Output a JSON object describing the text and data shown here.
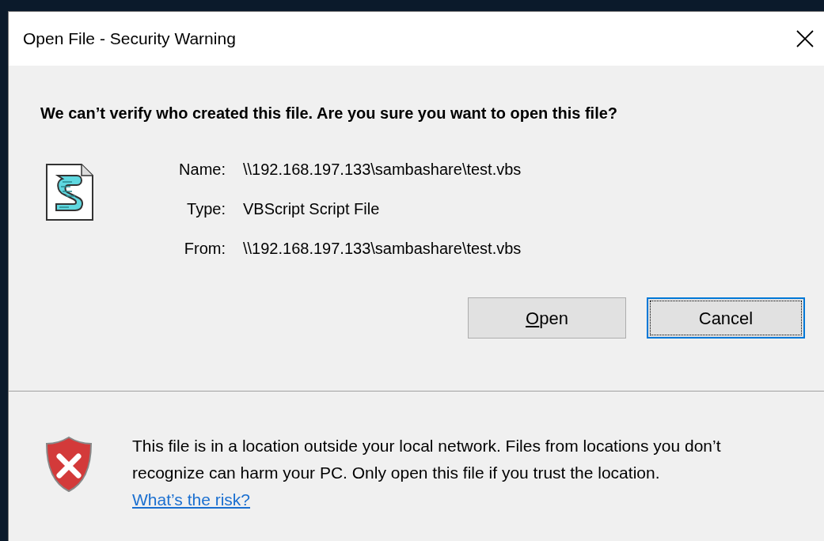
{
  "window": {
    "title": "Open File - Security Warning"
  },
  "heading": "We can’t verify who created this file. Are you sure you want to open this file?",
  "details": [
    {
      "label": "Name:",
      "value": "\\\\192.168.197.133\\sambashare\\test.vbs"
    },
    {
      "label": "Type:",
      "value": "VBScript Script File"
    },
    {
      "label": "From:",
      "value": "\\\\192.168.197.133\\sambashare\\test.vbs"
    }
  ],
  "buttons": [
    {
      "label": "Open",
      "focused": false,
      "mnemonic": true
    },
    {
      "label": "Cancel",
      "focused": true,
      "mnemonic": false
    }
  ],
  "warning": {
    "text": "This file is in a location outside your local network. Files from locations you don’t recognize can harm your PC. Only open this file if you trust the location.",
    "link": "What’s the risk?"
  }
}
